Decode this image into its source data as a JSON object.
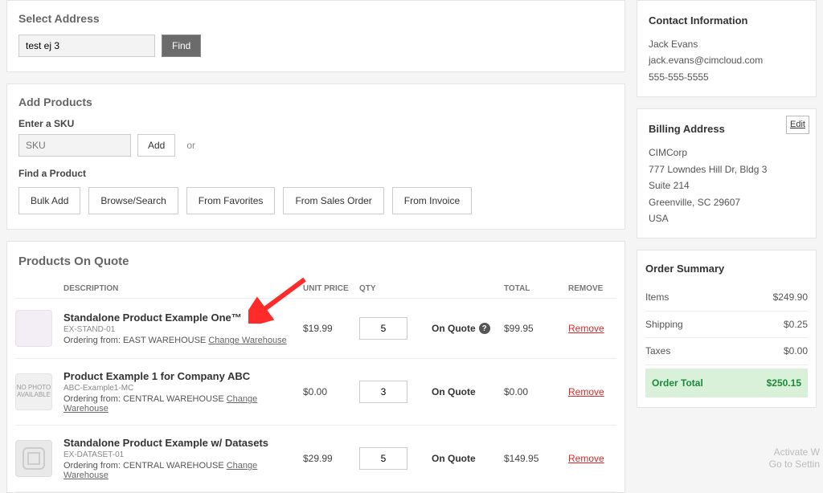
{
  "address": {
    "title": "Select Address",
    "value": "test ej 3",
    "find": "Find"
  },
  "addprod": {
    "title": "Add Products",
    "sku_label": "Enter a SKU",
    "sku_placeholder": "SKU",
    "add": "Add",
    "or": "or",
    "find_label": "Find a Product",
    "buttons": [
      "Bulk Add",
      "Browse/Search",
      "From Favorites",
      "From Sales Order",
      "From Invoice"
    ]
  },
  "products": {
    "title": "Products On Quote",
    "headers": {
      "desc": "DESCRIPTION",
      "price": "UNIT PRICE",
      "qty": "QTY",
      "total": "TOTAL",
      "remove": "REMOVE"
    },
    "status_label": "On Quote",
    "change_label": "Change Warehouse",
    "remove_label": "Remove",
    "rows": [
      {
        "name": "Standalone Product Example One™",
        "sku": "EX-STAND-01",
        "from": "Ordering from:  EAST WAREHOUSE",
        "price": "$19.99",
        "qty": "5",
        "total": "$99.95",
        "thumb": "pink",
        "qmark": true
      },
      {
        "name": "Product Example 1 for Company ABC",
        "sku": "ABC-Example1-MC",
        "from": "Ordering from:  CENTRAL WAREHOUSE",
        "price": "$0.00",
        "qty": "3",
        "total": "$0.00",
        "thumb": "nophoto",
        "qmark": false
      },
      {
        "name": "Standalone Product Example w/ Datasets",
        "sku": "EX-DATASET-01",
        "from": "Ordering from:  CENTRAL WAREHOUSE",
        "price": "$29.99",
        "qty": "5",
        "total": "$149.95",
        "thumb": "svg",
        "qmark": false
      }
    ]
  },
  "contact": {
    "title": "Contact Information",
    "name": "Jack Evans",
    "email": "jack.evans@cimcloud.com",
    "phone": "555-555-5555"
  },
  "billing": {
    "title": "Billing Address",
    "edit": "Edit",
    "lines": [
      "CIMCorp",
      "777 Lowndes Hill Dr, Bldg 3",
      "Suite 214",
      "Greenville, SC 29607",
      "USA"
    ]
  },
  "summary": {
    "title": "Order Summary",
    "rows": [
      {
        "label": "Items",
        "value": "$249.90"
      },
      {
        "label": "Shipping",
        "value": "$0.25"
      },
      {
        "label": "Taxes",
        "value": "$0.00"
      }
    ],
    "total_label": "Order Total",
    "total_value": "$250.15"
  },
  "watermark": {
    "line1": "Activate W",
    "line2": "Go to Settin"
  }
}
